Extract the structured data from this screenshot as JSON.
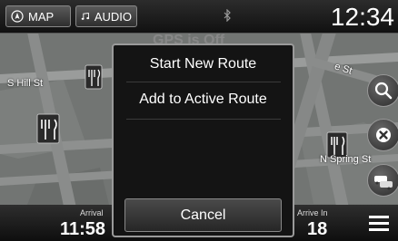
{
  "header": {
    "map_label": "MAP",
    "audio_label": "AUDIO",
    "time": "12:34"
  },
  "map": {
    "street_left": "S Hill St",
    "street_right": "N Spring St",
    "street_top_right": "e St",
    "background_title": "GPS is Off"
  },
  "footer": {
    "arrival_label": "Arrival",
    "arrival_value": "11:58",
    "arrive_in_label": "Arrive In",
    "arrive_in_value": "18"
  },
  "popup": {
    "items": [
      "Start New Route",
      "Add to Active Route"
    ],
    "cancel_label": "Cancel"
  },
  "icons": {
    "map": "compass-icon",
    "audio": "music-note-icon",
    "bluetooth": "bluetooth-icon",
    "search": "search-icon",
    "cancel_route": "cancel-route-icon",
    "traffic": "traffic-icon",
    "menu": "menu-icon",
    "restaurant": "restaurant-icon"
  }
}
